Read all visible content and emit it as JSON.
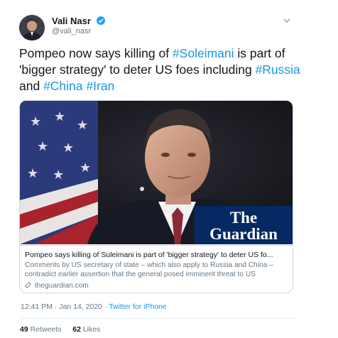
{
  "author": {
    "name": "Vali Nasr",
    "handle": "@vali_nasr",
    "verified": true
  },
  "tweet": {
    "segments": [
      {
        "text": "Pompeo now says killing of ",
        "type": "text"
      },
      {
        "text": "#Soleimani",
        "type": "hashtag"
      },
      {
        "text": " is part of 'bigger strategy' to deter US foes including ",
        "type": "text"
      },
      {
        "text": "#Russia",
        "type": "hashtag"
      },
      {
        "text": " and ",
        "type": "text"
      },
      {
        "text": "#China",
        "type": "hashtag"
      },
      {
        "text": " ",
        "type": "text"
      },
      {
        "text": "#Iran",
        "type": "hashtag"
      }
    ]
  },
  "card": {
    "image_logo": [
      "The",
      "Guardian"
    ],
    "title": "Pompeo says killing of Suleimani is part of 'bigger strategy' to deter US fo...",
    "description": "Comments by US secretary of state – which also apply to Russia and China – contradict earlier assertion that the general posed imminent threat to US",
    "domain": "theguardian.com",
    "link_icon": "link-icon"
  },
  "meta": {
    "time": "12:41 PM · Jan 14, 2020 · ",
    "source": "Twitter for iPhone"
  },
  "stats": {
    "retweets_count": "49",
    "retweets_label": "Retweets",
    "likes_count": "62",
    "likes_label": "Likes"
  },
  "colors": {
    "link": "#1b95e0",
    "verified": "#1da1f2",
    "guardian_blue": "#052962",
    "secondary_text": "#657786"
  },
  "icons": {
    "verified": "verified-badge-icon",
    "menu": "chevron-down-icon"
  }
}
